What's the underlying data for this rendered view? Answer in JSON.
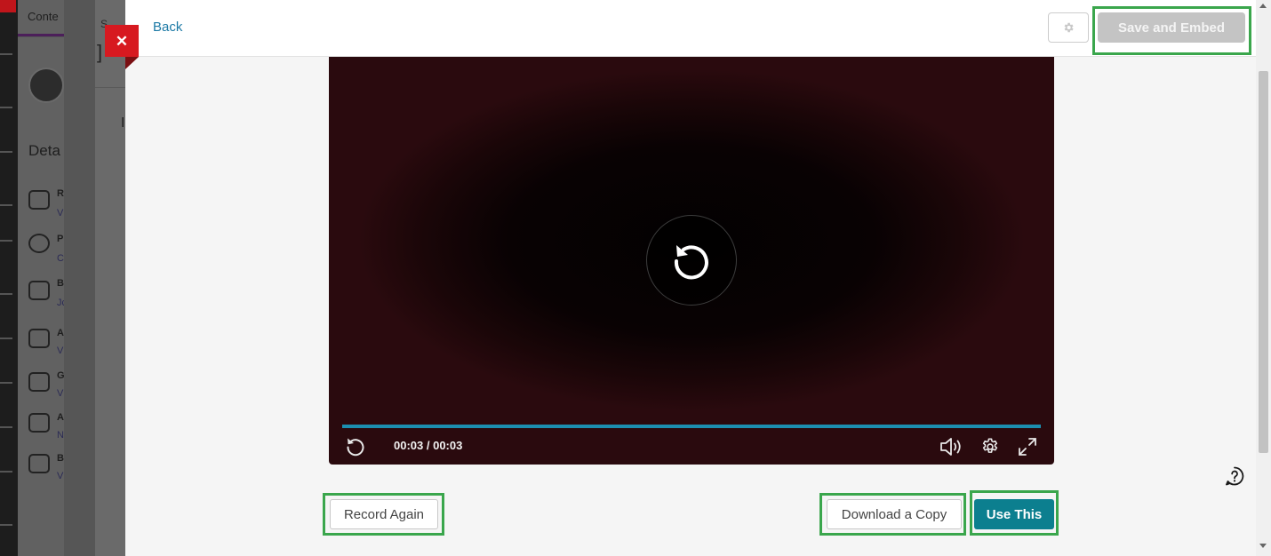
{
  "background": {
    "tab_label": "Conte",
    "panel_s": "S",
    "panel_b": "]",
    "panel_l": "I",
    "heading": "Deta",
    "rows": [
      {
        "letter": "R",
        "sub": "V"
      },
      {
        "letter": "P",
        "sub": "C"
      },
      {
        "letter": "B",
        "sub": "Jc"
      },
      {
        "letter": "A",
        "sub": "V"
      },
      {
        "letter": "G",
        "sub": "V"
      },
      {
        "letter": "A",
        "sub": "N"
      },
      {
        "letter": "B",
        "sub": "V"
      }
    ]
  },
  "modal": {
    "back_label": "Back",
    "save_label": "Save and Embed",
    "close_label": "✕"
  },
  "player": {
    "time_display": "00:03 / 00:03",
    "progress": 1.0,
    "icons": {
      "center": "replay-icon",
      "replay": "replay-icon",
      "volume": "volume-icon",
      "settings": "gear-icon",
      "fullscreen": "fullscreen-icon"
    }
  },
  "actions": {
    "record_again": "Record Again",
    "download_copy": "Download a Copy",
    "use_this": "Use This"
  },
  "colors": {
    "accent_teal": "#0c7f8f",
    "link_blue": "#1d7aa6",
    "close_red": "#d71920",
    "highlight_green": "#3aa64c"
  }
}
